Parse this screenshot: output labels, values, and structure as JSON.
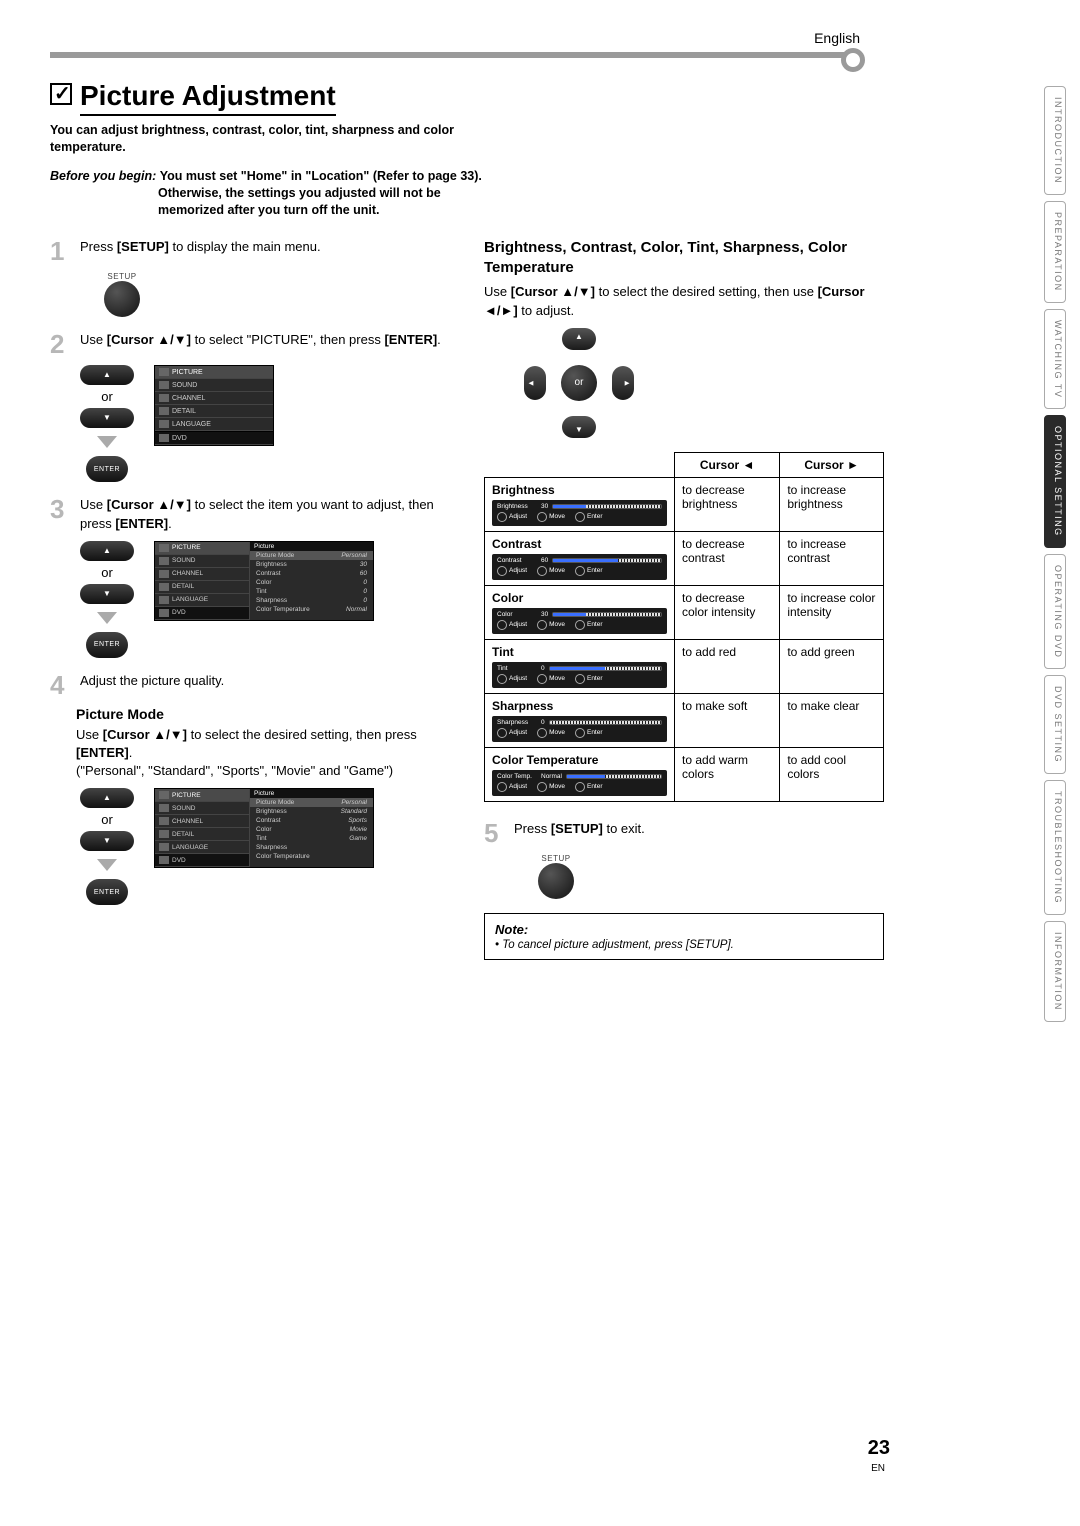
{
  "language": "English",
  "pageTitle": "Picture Adjustment",
  "intro": "You can adjust brightness, contrast, color, tint, sharpness and color temperature.",
  "before": {
    "label": "Before you begin:",
    "line1": "You must set \"Home\" in \"Location\" (Refer to page 33).",
    "line2": "Otherwise, the settings you adjusted will not be memorized after you turn off the unit."
  },
  "steps": {
    "s1": {
      "num": "1",
      "text_pre": "Press ",
      "b1": "[SETUP]",
      "text_post": " to display the main menu."
    },
    "s2": {
      "num": "2",
      "text_pre": "Use ",
      "b1": "[Cursor ▲/▼]",
      "mid": " to select \"PICTURE\", then press ",
      "b2": "[ENTER]",
      "post": "."
    },
    "s3": {
      "num": "3",
      "text_pre": "Use ",
      "b1": "[Cursor ▲/▼]",
      "mid": " to select the item you want to adjust, then press ",
      "b2": "[ENTER]",
      "post": "."
    },
    "s4": {
      "num": "4",
      "text": "Adjust the picture quality."
    },
    "s5": {
      "num": "5",
      "text_pre": "Press ",
      "b1": "[SETUP]",
      "text_post": " to exit."
    }
  },
  "setupLabel": "SETUP",
  "enterLabel": "ENTER",
  "or": "or",
  "pictureMode": {
    "heading": "Picture Mode",
    "text_pre": "Use ",
    "b1": "[Cursor ▲/▼]",
    "mid": " to select the desired setting, then press ",
    "b2": "[ENTER]",
    "post": ".",
    "options": "(\"Personal\", \"Standard\", \"Sports\", \"Movie\" and \"Game\")"
  },
  "rightHeading": "Brightness, Contrast, Color, Tint, Sharpness, Color Temperature",
  "rightText": {
    "pre": "Use ",
    "b1": "[Cursor ▲/▼]",
    "mid": " to select the desired setting, then use ",
    "b2": "[Cursor ◄/►]",
    "post": " to adjust."
  },
  "dpadCenter": "or",
  "tableHeaders": {
    "left": "Cursor ◄",
    "right": "Cursor ►"
  },
  "adjust": [
    {
      "label": "Brightness",
      "val": "30",
      "fill": 30,
      "left": "to decrease brightness",
      "right": "to increase brightness"
    },
    {
      "label": "Contrast",
      "val": "60",
      "fill": 60,
      "left": "to decrease contrast",
      "right": "to increase contrast"
    },
    {
      "label": "Color",
      "val": "30",
      "fill": 30,
      "left": "to decrease color intensity",
      "right": "to increase color intensity"
    },
    {
      "label": "Tint",
      "val": "0",
      "fill": 50,
      "left": "to add red",
      "right": "to add green"
    },
    {
      "label": "Sharpness",
      "val": "0",
      "fill": 0,
      "left": "to make soft",
      "right": "to make clear"
    },
    {
      "label": "Color Temperature",
      "osdname": "Color Temp.",
      "val": "Normal",
      "fill": 40,
      "left": "to add warm colors",
      "right": "to add cool colors"
    }
  ],
  "barButtons": {
    "adjust": "Adjust",
    "move": "Move",
    "enter": "Enter"
  },
  "note": {
    "title": "Note:",
    "body": "To cancel picture adjustment, press [SETUP]."
  },
  "osdMenu1": [
    "PICTURE",
    "SOUND",
    "CHANNEL",
    "DETAIL",
    "LANGUAGE",
    "DVD"
  ],
  "osdMenu2Hdr": "Picture",
  "osdMenu2": [
    {
      "k": "Picture Mode",
      "v": "Personal"
    },
    {
      "k": "Brightness",
      "v": "30"
    },
    {
      "k": "Contrast",
      "v": "60"
    },
    {
      "k": "Color",
      "v": "0"
    },
    {
      "k": "Tint",
      "v": "0"
    },
    {
      "k": "Sharpness",
      "v": "0"
    },
    {
      "k": "Color Temperature",
      "v": "Normal"
    }
  ],
  "osdMenu3Opts": [
    "Personal",
    "Standard",
    "Sports",
    "Movie",
    "Game"
  ],
  "sideTabs": [
    "INTRODUCTION",
    "PREPARATION",
    "WATCHING TV",
    "OPTIONAL SETTING",
    "OPERATING DVD",
    "DVD SETTING",
    "TROUBLESHOOTING",
    "INFORMATION"
  ],
  "sideActiveIndex": 3,
  "pageNumber": "23",
  "pageLang": "EN"
}
